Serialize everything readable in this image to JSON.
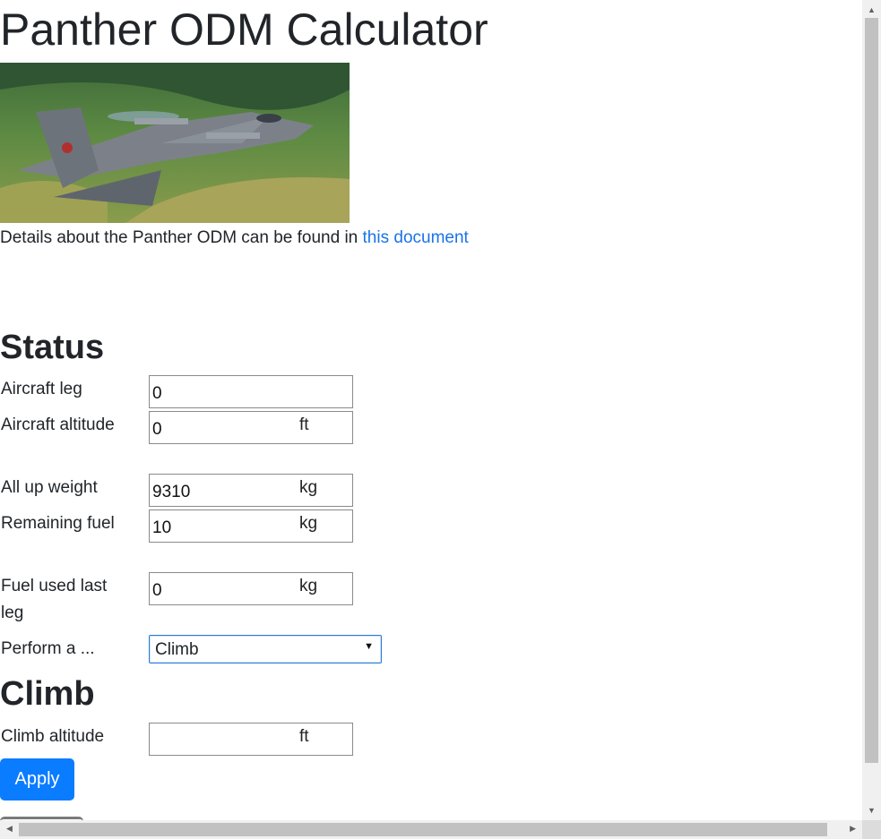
{
  "header": {
    "title": "Panther ODM Calculator"
  },
  "intro": {
    "text": "Details about the Panther ODM can be found in ",
    "link": "this document"
  },
  "status": {
    "heading": "Status",
    "fields": [
      {
        "label": "Aircraft leg",
        "value": "0",
        "unit": ""
      },
      {
        "label": "Aircraft altitude",
        "value": "0",
        "unit": "ft"
      },
      {
        "label": "All up weight",
        "value": "9310",
        "unit": "kg"
      },
      {
        "label": "Remaining fuel",
        "value": "10",
        "unit": "kg"
      },
      {
        "label": "Fuel used last leg",
        "value": "0",
        "unit": "kg"
      }
    ],
    "perform_label": "Perform a ...",
    "perform_selected": "Climb"
  },
  "climb": {
    "heading": "Climb",
    "altitude_label": "Climb altitude",
    "altitude_value": "",
    "altitude_unit": "ft",
    "apply_label": "Apply"
  },
  "colors": {
    "accent": "#0a7cff",
    "link": "#1a73e8",
    "text": "#212529"
  },
  "icons": {
    "dropdown": "caret-down-icon"
  }
}
